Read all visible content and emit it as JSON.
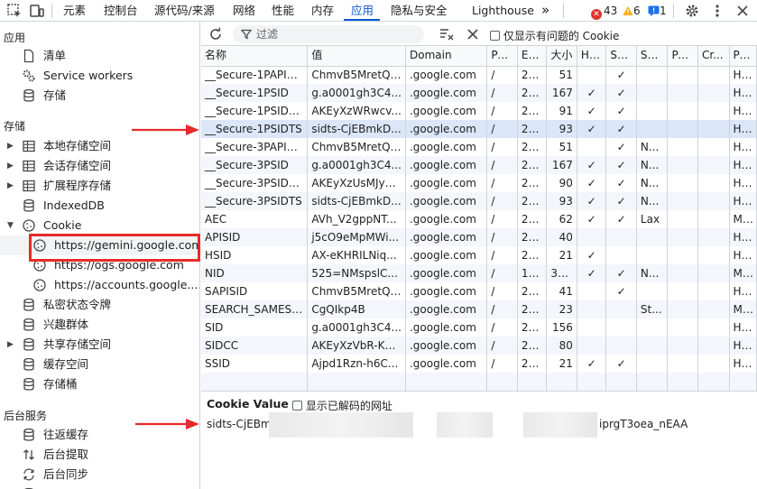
{
  "tabbar": {
    "tabs": [
      {
        "label": "元素"
      },
      {
        "label": "控制台"
      },
      {
        "label": "源代码/来源"
      },
      {
        "label": "网络"
      },
      {
        "label": "性能"
      },
      {
        "label": "内存"
      },
      {
        "label": "应用",
        "active": true
      },
      {
        "label": "隐私与安全"
      },
      {
        "label": "Lighthouse"
      }
    ],
    "more_label": "»",
    "errors": "43",
    "warnings": "6",
    "issues": "1"
  },
  "sidebar": {
    "sections": {
      "app": "应用",
      "storage": "存储",
      "background": "后台服务"
    },
    "app_items": [
      {
        "label": "清单",
        "icon": "document-icon"
      },
      {
        "label": "Service workers",
        "icon": "gears-icon"
      },
      {
        "label": "存储",
        "icon": "database-icon"
      }
    ],
    "storage_items": [
      {
        "label": "本地存储空间",
        "icon": "table-icon"
      },
      {
        "label": "会话存储空间",
        "icon": "table-icon"
      },
      {
        "label": "扩展程序存储",
        "icon": "table-icon"
      },
      {
        "label": "IndexedDB",
        "icon": "database-icon"
      },
      {
        "label": "Cookie",
        "icon": "cookie-icon"
      },
      {
        "label": "https://gemini.google.com",
        "icon": "cookie-icon"
      },
      {
        "label": "https://ogs.google.com",
        "icon": "cookie-icon"
      },
      {
        "label": "https://accounts.google....",
        "icon": "cookie-icon"
      },
      {
        "label": "私密状态令牌",
        "icon": "database-icon"
      },
      {
        "label": "兴趣群体",
        "icon": "database-icon"
      },
      {
        "label": "共享存储空间",
        "icon": "database-icon"
      },
      {
        "label": "缓存空间",
        "icon": "database-icon"
      },
      {
        "label": "存储桶",
        "icon": "database-icon"
      }
    ],
    "background_items": [
      {
        "label": "往返缓存",
        "icon": "database-icon"
      },
      {
        "label": "后台提取",
        "icon": "updown-arrows-icon"
      },
      {
        "label": "后台同步",
        "icon": "sync-icon"
      }
    ]
  },
  "toolbar": {
    "filter_placeholder": "过滤",
    "only_issues_label": "仅显示有问题的 Cookie"
  },
  "cookies": {
    "columns": [
      "名称",
      "值",
      "Domain",
      "Pa...",
      "Ex...",
      "大小",
      "Ht...",
      "Se...",
      "Sa...",
      "Pa...",
      "Cr...",
      "Pri..."
    ],
    "rows": [
      [
        "__Secure-1PAPISID",
        "ChmvB5MretQi...",
        ".google.com",
        "/",
        "20...",
        "51",
        "",
        "✓",
        "",
        "",
        "",
        "Hi..."
      ],
      [
        "__Secure-1PSID",
        "g.a0001gh3C4...",
        ".google.com",
        "/",
        "20...",
        "167",
        "✓",
        "✓",
        "",
        "",
        "",
        "Hi..."
      ],
      [
        "__Secure-1PSIDCC",
        "AKEyXzWRwcv...",
        ".google.com",
        "/",
        "20...",
        "91",
        "✓",
        "✓",
        "",
        "",
        "",
        "Hi..."
      ],
      [
        "__Secure-1PSIDTS",
        "sidts-CjEBmkD...",
        ".google.com",
        "/",
        "20...",
        "93",
        "✓",
        "✓",
        "",
        "",
        "",
        "Hi..."
      ],
      [
        "__Secure-3PAPISID",
        "ChmvB5MretQi...",
        ".google.com",
        "/",
        "20...",
        "51",
        "",
        "✓",
        "N...",
        "",
        "",
        "Hi..."
      ],
      [
        "__Secure-3PSID",
        "g.a0001gh3C4...",
        ".google.com",
        "/",
        "20...",
        "167",
        "✓",
        "✓",
        "N...",
        "",
        "",
        "Hi..."
      ],
      [
        "__Secure-3PSIDCC",
        "AKEyXzUsMJy5...",
        ".google.com",
        "/",
        "20...",
        "90",
        "✓",
        "✓",
        "N...",
        "",
        "",
        "Hi..."
      ],
      [
        "__Secure-3PSIDTS",
        "sidts-CjEBmkD...",
        ".google.com",
        "/",
        "20...",
        "93",
        "✓",
        "✓",
        "N...",
        "",
        "",
        "Hi..."
      ],
      [
        "AEC",
        "AVh_V2gppNT...",
        ".google.com",
        "/",
        "20...",
        "62",
        "✓",
        "✓",
        "Lax",
        "",
        "",
        "M..."
      ],
      [
        "APISID",
        "j5cO9eMpMWi...",
        ".google.com",
        "/",
        "20...",
        "40",
        "",
        "",
        "",
        "",
        "",
        "Hi..."
      ],
      [
        "HSID",
        "AX-eKHRILNiq...",
        ".google.com",
        "/",
        "20...",
        "21",
        "✓",
        "",
        "",
        "",
        "",
        "Hi..."
      ],
      [
        "NID",
        "525=NMspslC...",
        ".google.com",
        "/",
        "15...",
        "31...",
        "✓",
        "✓",
        "N...",
        "",
        "",
        "M..."
      ],
      [
        "SAPISID",
        "ChmvB5MretQi...",
        ".google.com",
        "/",
        "20...",
        "41",
        "",
        "✓",
        "",
        "",
        "",
        "Hi..."
      ],
      [
        "SEARCH_SAMESI...",
        "CgQIkp4B",
        ".google.com",
        "/",
        "20...",
        "23",
        "",
        "",
        "St...",
        "",
        "",
        "M..."
      ],
      [
        "SID",
        "g.a0001gh3C4...",
        ".google.com",
        "/",
        "20...",
        "156",
        "",
        "",
        "",
        "",
        "",
        "Hi..."
      ],
      [
        "SIDCC",
        "AKEyXzVbR-K9...",
        ".google.com",
        "/",
        "20...",
        "80",
        "",
        "",
        "",
        "",
        "",
        "Hi..."
      ],
      [
        "SSID",
        "Ajpd1Rzn-h6C...",
        ".google.com",
        "/",
        "20...",
        "21",
        "✓",
        "✓",
        "",
        "",
        "",
        "Hi..."
      ]
    ],
    "selected_row": 3
  },
  "cookie_value": {
    "title": "Cookie Value",
    "decode_label": "显示已解码的网址",
    "value_start": "sidts-CjEBm",
    "value_end": "iprgT3oea_nEAA"
  },
  "colors": {
    "accent": "#0b57d0",
    "annotation_red": "#e52b2b",
    "error_red": "#dc362e",
    "warning_orange": "#f9ab00",
    "issue_blue": "#1a73e8"
  }
}
